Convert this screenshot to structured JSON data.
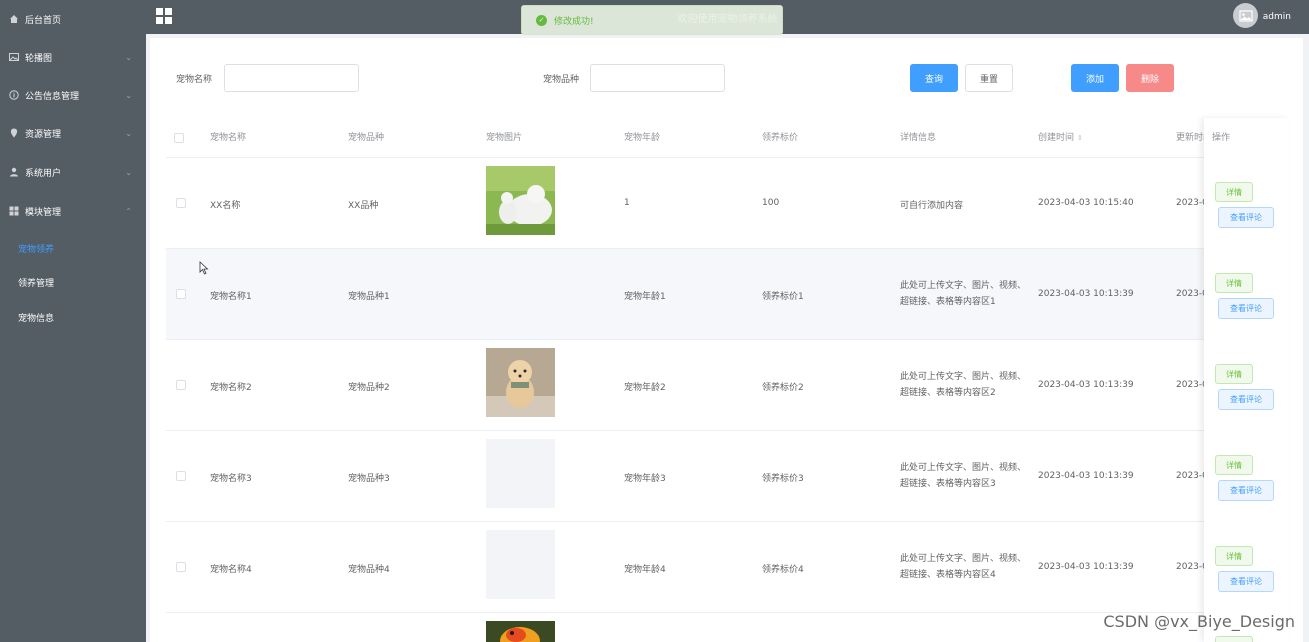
{
  "header": {
    "welcome": "欢迎使用宠物领养系统",
    "user": "admin"
  },
  "toast": {
    "message": "修改成功!"
  },
  "sidebar": {
    "items": [
      {
        "label": "后台首页",
        "icon": "home-icon"
      },
      {
        "label": "轮播图",
        "icon": "image-icon"
      },
      {
        "label": "公告信息管理",
        "icon": "info-icon"
      },
      {
        "label": "资源管理",
        "icon": "location-icon"
      },
      {
        "label": "系统用户",
        "icon": "user-icon"
      },
      {
        "label": "模块管理",
        "icon": "grid-icon"
      }
    ],
    "subitems": [
      {
        "label": "宠物领养",
        "active": true
      },
      {
        "label": "领养管理",
        "active": false
      },
      {
        "label": "宠物信息",
        "active": false
      }
    ]
  },
  "search": {
    "name_label": "宠物名称",
    "breed_label": "宠物品种",
    "query": "查询",
    "reset": "重置",
    "add": "添加",
    "delete": "删除"
  },
  "table": {
    "headers": [
      "宠物名称",
      "宠物品种",
      "宠物图片",
      "宠物年龄",
      "领养标价",
      "详情信息",
      "创建时间",
      "更新时间",
      "操作"
    ],
    "rows": [
      {
        "name": "XX名称",
        "breed": "XX品种",
        "age": "1",
        "price": "100",
        "detail": "可自行添加内容",
        "created": "2023-04-03 10:15:40",
        "updated": "2023-0"
      },
      {
        "name": "宠物名称1",
        "breed": "宠物品种1",
        "age": "宠物年龄1",
        "price": "领养标价1",
        "detail": "此处可上传文字、图片、视频、超链接、表格等内容区1",
        "created": "2023-04-03 10:13:39",
        "updated": "2023-0"
      },
      {
        "name": "宠物名称2",
        "breed": "宠物品种2",
        "age": "宠物年龄2",
        "price": "领养标价2",
        "detail": "此处可上传文字、图片、视频、超链接、表格等内容区2",
        "created": "2023-04-03 10:13:39",
        "updated": "2023-0"
      },
      {
        "name": "宠物名称3",
        "breed": "宠物品种3",
        "age": "宠物年龄3",
        "price": "领养标价3",
        "detail": "此处可上传文字、图片、视频、超链接、表格等内容区3",
        "created": "2023-04-03 10:13:39",
        "updated": "2023-0"
      },
      {
        "name": "宠物名称4",
        "breed": "宠物品种4",
        "age": "宠物年龄4",
        "price": "领养标价4",
        "detail": "此处可上传文字、图片、视频、超链接、表格等内容区4",
        "created": "2023-04-03 10:13:39",
        "updated": "2023-0"
      }
    ],
    "op_detail": "详情",
    "op_comment": "查看评论"
  },
  "watermark": "CSDN @vx_Biye_Design"
}
